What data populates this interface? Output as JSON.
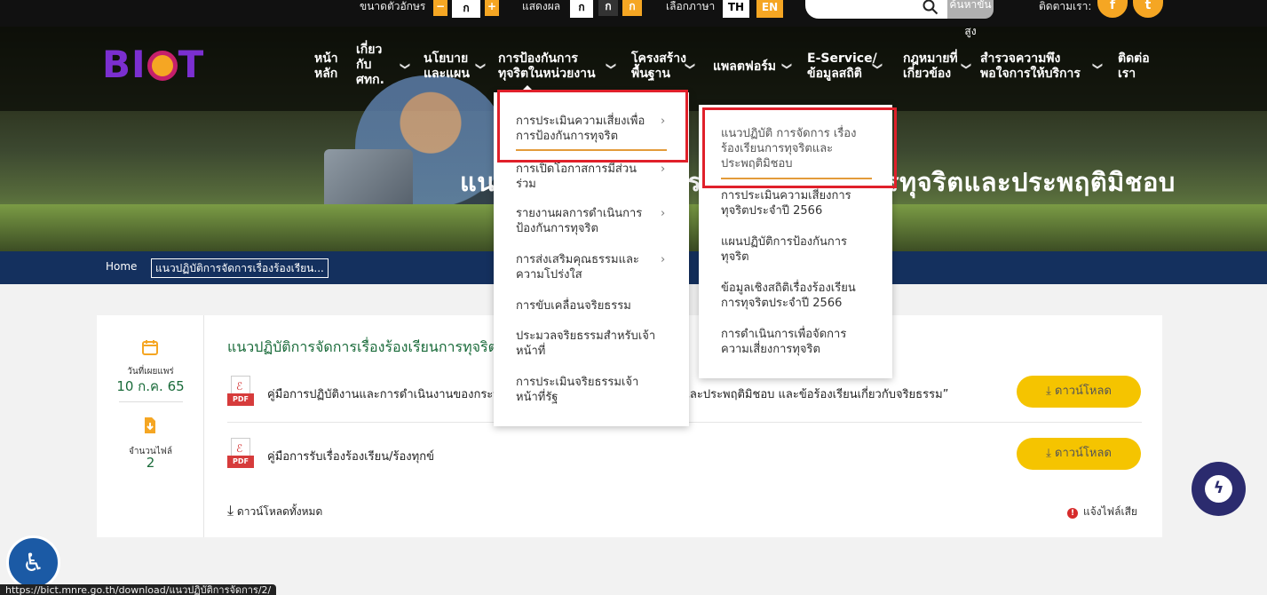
{
  "topbar": {
    "font_size_label": "ขนาดตัวอักษร",
    "font_minus": "−",
    "font_normal": "ก",
    "font_plus": "+",
    "display_label": "แสดงผล",
    "display_opts": [
      "ก",
      "ก",
      "ก"
    ],
    "language_label": "เลือกภาษา",
    "lang_th": "TH",
    "lang_en": "EN",
    "search_placeholder": "",
    "search_button": "ค้นหาขั้นสูง",
    "follow_label": "ติดตามเรา:",
    "facebook": "f",
    "twitter": "t"
  },
  "logo": {
    "text_left": "BI",
    "text_right": "T"
  },
  "nav": [
    {
      "label": "หน้า\nหลัก"
    },
    {
      "label": "เกี่ยว\nกับ\nศทก."
    },
    {
      "label": "นโยบาย\nและแผน"
    },
    {
      "label": "การป้องกันการ\nทุจริตในหน่วยงาน"
    },
    {
      "label": "โครงสร้าง\nพื้นฐาน"
    },
    {
      "label": "แพลตฟอร์ม"
    },
    {
      "label": "E-Service/\nข้อมูลสถิติ"
    },
    {
      "label": "กฎหมายที่\nเกี่ยวข้อง"
    },
    {
      "label": "สำรวจความพึง\nพอใจการให้บริการ"
    },
    {
      "label": "ติดต่อ\nเรา"
    }
  ],
  "hero": {
    "title": "แนวปฏิบัติการจัดการเรื่องร้องเรียนการทุจริตและประพฤติมิชอบ"
  },
  "breadcrumb": {
    "home": "Home",
    "current": "แนวปฏิบัติการจัดการเรื่องร้องเรียน..."
  },
  "dropdown1": [
    "การประเมินความเสี่ยงเพื่อ\nการป้องกันการทุจริต",
    "การเปิดโอกาสการมีส่วน\nร่วม",
    "รายงานผลการดำเนินการ\nป้องกันการทุจริต",
    "การส่งเสริมคุณธรรมและ\nความโปร่งใส",
    "การขับเคลื่อนจริยธรรม",
    "ประมวลจริยธรรมสำหรับเจ้า\nหน้าที่",
    "การประเมินจริยธรรมเจ้า\nหน้าที่รัฐ"
  ],
  "dropdown2": [
    "แนวปฏิบัติ การจัดการ เรื่อง\nร้องเรียนการทุจริตและ\nประพฤติมิชอบ",
    "การประเมินความเสี่ยงการ\nทุจริตประจำปี 2566",
    "แผนปฏิบัติการป้องกันการ\nทุจริต",
    "ข้อมูลเชิงสถิติเรื่องร้องเรียน\nการทุจริตประจำปี 2566",
    "การดำเนินการเพื่อจัดการ\nความเสี่ยงการทุจริต"
  ],
  "card": {
    "publish_label": "วันที่เผยแพร่",
    "publish_date": "10 ก.ค. 65",
    "files_label": "จำนวนไฟล์",
    "files_count": "2",
    "title": "แนวปฏิบัติการจัดการเรื่องร้องเรียนการทุจริตและประพฤติมิชอบ",
    "files": [
      {
        "name": "คู่มือการปฏิบัติงานและการดำเนินงานของกระบวนการจัดการเรื่องร้องเรียนการทุจริตและประพฤติมิชอบ และข้อร้องเรียนเกี่ยวกับจริยธรรม”",
        "button": "ดาวน์โหลด"
      },
      {
        "name": "คู่มือการรับเรื่องร้องเรียน/ร้องทุกข์",
        "button": "ดาวน์โหลด"
      }
    ],
    "pdf_tag": "PDF",
    "download_all": "ดาวน์โหลดทั้งหมด",
    "report_broken": "แจ้งไฟล์เสีย"
  },
  "status_url": "https://bict.mnre.go.th/download/แนวปฏิบัติการจัดการ/2/",
  "colors": {
    "accent": "#f5a623",
    "navy": "#14305e",
    "green": "#1a6b3a",
    "highlight": "#e0202a"
  }
}
